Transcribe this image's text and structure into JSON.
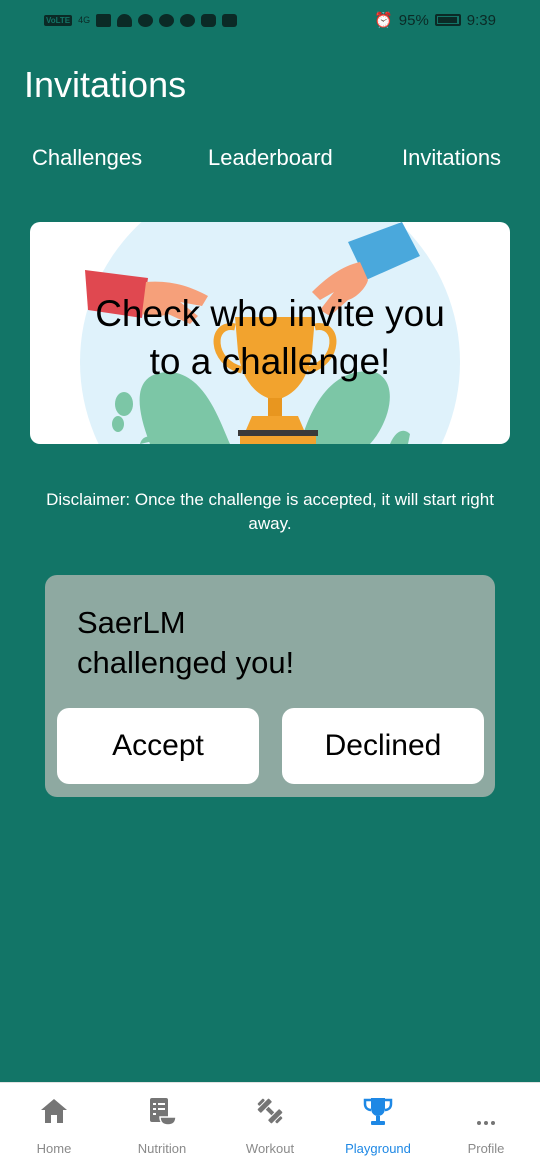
{
  "status_bar": {
    "left_indicators": [
      "VoLTE",
      "4G",
      "signal",
      "wifi"
    ],
    "battery": "95%",
    "time": "9:39"
  },
  "header": {
    "title": "Invitations"
  },
  "tabs": [
    {
      "label": "Challenges"
    },
    {
      "label": "Leaderboard"
    },
    {
      "label": "Invitations"
    }
  ],
  "banner": {
    "line1": "Check who invite you",
    "line2": "to a challenge!",
    "colors": {
      "circle": "#dff2fb",
      "leaf": "#7cc6a6",
      "trophy": "#f2a32e",
      "sleeve_left": "#e04850",
      "sleeve_right": "#4aa8dc",
      "hand": "#f6a07a"
    }
  },
  "disclaimer": "Disclaimer: Once the challenge is accepted, it will start right away.",
  "invitation": {
    "line1": "SaerLM",
    "line2": "challenged you!",
    "accept_label": "Accept",
    "decline_label": "Declined"
  },
  "bottom_nav": {
    "items": [
      {
        "label": "Home",
        "icon": "home-icon"
      },
      {
        "label": "Nutrition",
        "icon": "nutrition-icon"
      },
      {
        "label": "Workout",
        "icon": "dumbbell-icon"
      },
      {
        "label": "Playground",
        "icon": "trophy-icon",
        "active": true
      },
      {
        "label": "Profile",
        "icon": "more-icon"
      }
    ],
    "active_color": "#1e88e5",
    "inactive_color": "#8a8a8a"
  },
  "colors": {
    "background": "#127567",
    "card": "#8ea9a1"
  }
}
